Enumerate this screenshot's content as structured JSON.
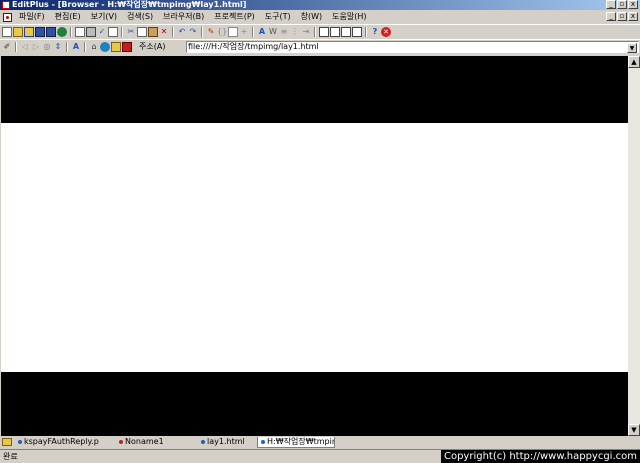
{
  "window": {
    "title": "EditPlus - [Browser - H:₩작업장₩tmpimg₩lay1.html]",
    "minimize_glyph": "_",
    "maximize_glyph": "▫",
    "close_glyph": "x"
  },
  "menu": {
    "items": [
      "파일(F)",
      "편집(E)",
      "보기(V)",
      "검색(S)",
      "브라우저(B)",
      "프로젝트(P)",
      "도구(T)",
      "창(W)",
      "도움말(H)"
    ]
  },
  "toolbar": {
    "icons": [
      "new",
      "open",
      "open-remote",
      "save",
      "save-all",
      "ftp",
      "print-preview",
      "print",
      "spell-check",
      "preview",
      "cut",
      "copy",
      "paste",
      "delete",
      "undo",
      "redo",
      "hand-tool",
      "match-brace",
      "duplicate",
      "insert",
      "format",
      "word-wrap",
      "line-number",
      "ruler",
      "indent",
      "window-1",
      "window-2",
      "window-3",
      "window-4",
      "help",
      "stop"
    ]
  },
  "browser_toolbar": {
    "address_label": "주소(A)",
    "address_value": "file:///H:/작업장/tmpimg/lay1.html"
  },
  "tabs": [
    {
      "label": "kspayFAuthReply.p",
      "color": "#2060c0"
    },
    {
      "label": "Noname1",
      "color": "#c02020"
    },
    {
      "label": "lay1.html",
      "color": "#2060c0"
    },
    {
      "label": "H:₩작업장₩tmpim",
      "color": "#2060c0",
      "active": true
    }
  ],
  "status": {
    "text": "완료",
    "copyright": "Copyright(c) http://www.happycgi.com"
  },
  "colors": {
    "title_start": "#0a246a",
    "page_band": "#000000",
    "page_background": "#ffffff"
  }
}
